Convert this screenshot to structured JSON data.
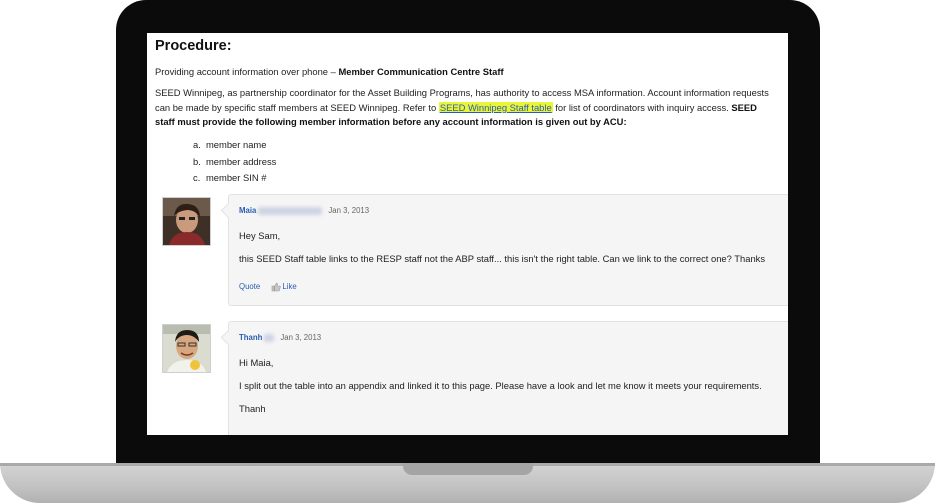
{
  "procedure": {
    "heading": "Procedure:",
    "intro_text": "Providing account information over phone – ",
    "intro_bold": "Member Communication Centre Staff",
    "p2_before": "SEED Winnipeg, as partnership coordinator for the Asset Building Programs, has authority to access MSA information. Account information requests can be made by specific staff members at SEED Winnipeg. Refer to ",
    "p2_link": "SEED Winnipeg Staff table",
    "p2_after": " for list of coordinators with inquiry access. ",
    "p2_bold": "SEED staff must provide the following member information before any account information is given out by ACU:",
    "items": [
      {
        "marker": "a.",
        "text": "member name"
      },
      {
        "marker": "b.",
        "text": "member address"
      },
      {
        "marker": "c.",
        "text": "member SIN #"
      }
    ]
  },
  "comments": [
    {
      "author": "Maia",
      "date": "Jan 3, 2013",
      "lines": [
        "Hey Sam,",
        "this SEED Staff table links to the RESP staff not the ABP staff... this isn't the right table. Can we link to the correct one? Thanks"
      ],
      "quote_label": "Quote",
      "like_label": "Like"
    },
    {
      "author": "Thanh",
      "date": "Jan 3, 2013",
      "lines": [
        "Hi Maia,",
        "I split out the table into an appendix and linked it to this page. Please have a look and let me know it meets your requirements.",
        "Thanh"
      ]
    }
  ],
  "colors": {
    "link": "#2a5db0",
    "highlight": "#e8f53b",
    "bezel": "#0b0b0b",
    "bubble": "#f5f5f5"
  }
}
